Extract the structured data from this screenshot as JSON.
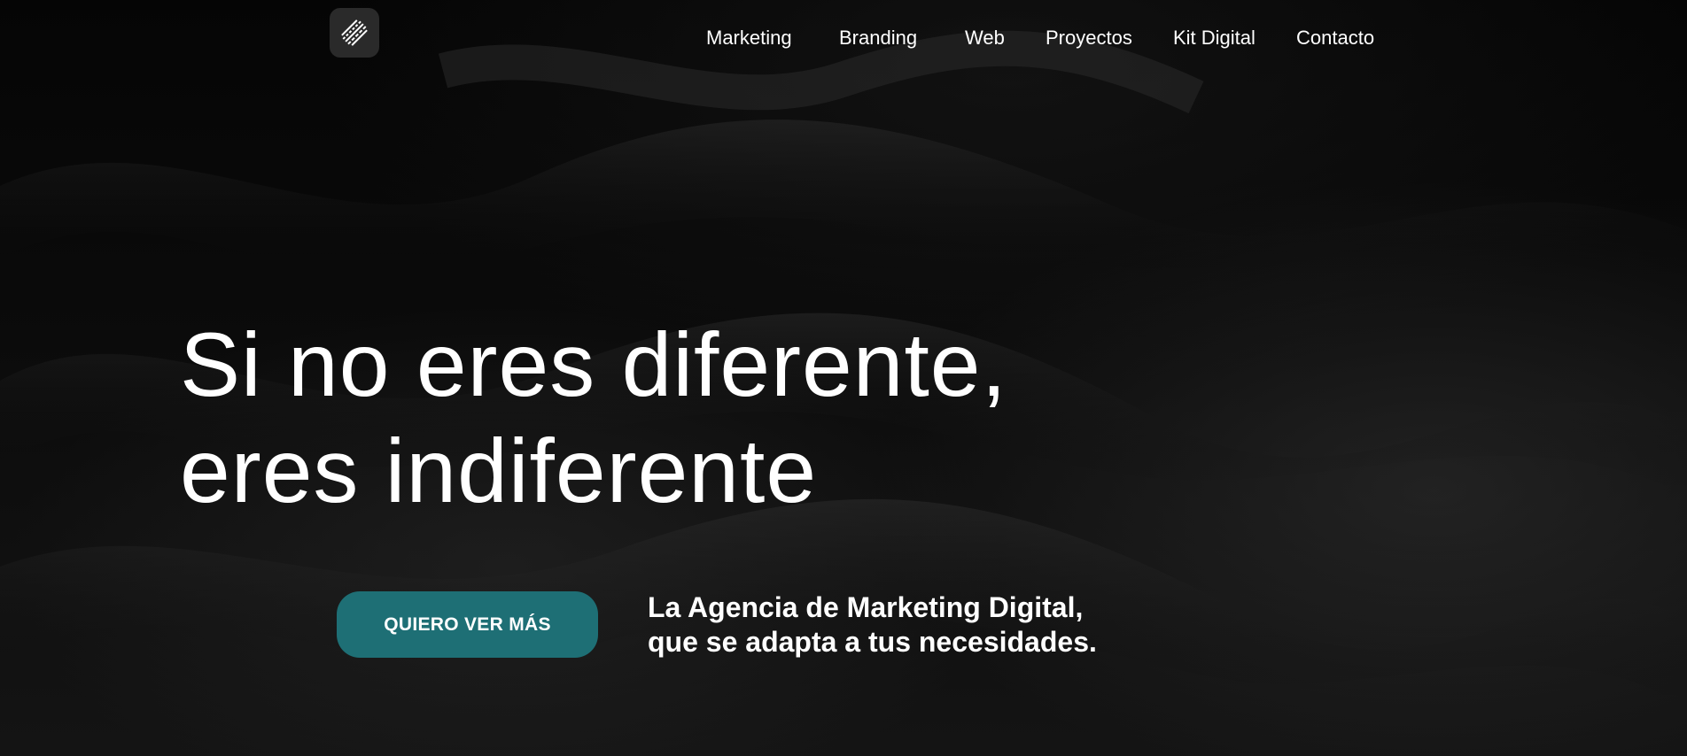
{
  "nav": {
    "items": [
      {
        "label": "Marketing"
      },
      {
        "label": "Branding"
      },
      {
        "label": "Web"
      },
      {
        "label": "Proyectos"
      },
      {
        "label": "Kit Digital"
      },
      {
        "label": "Contacto"
      }
    ]
  },
  "hero": {
    "headline_line1": "Si no eres diferente,",
    "headline_line2": "eres indiferente",
    "cta_label": "QUIERO VER MÁS",
    "tagline_line1": "La Agencia de Marketing Digital,",
    "tagline_line2": "que se adapta a tus necesidades."
  },
  "colors": {
    "background": "#050505",
    "accent": "#1e6f75",
    "text": "#ffffff",
    "logo_tile": "#2a2a2a"
  },
  "icons": {
    "logo": "agency-logo-icon"
  }
}
